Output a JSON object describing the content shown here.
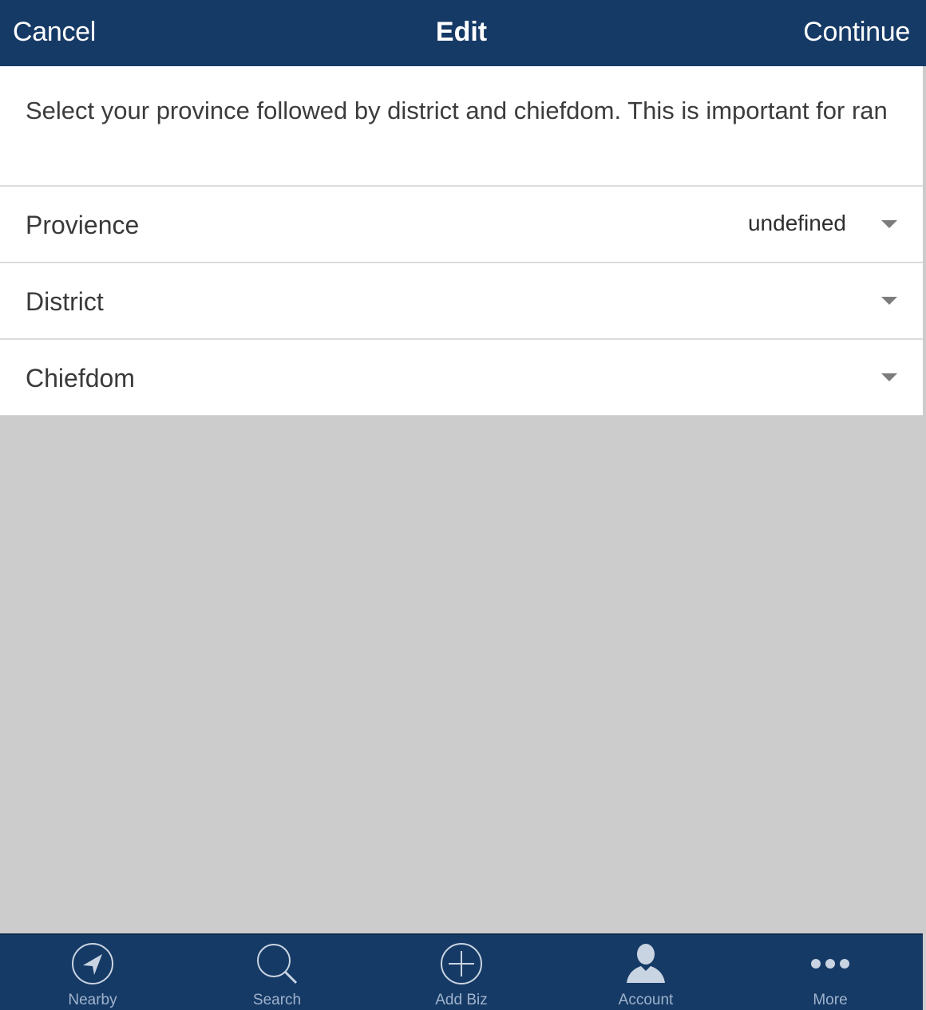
{
  "navbar": {
    "left_button": "Cancel",
    "title": "Edit",
    "right_button": "Continue"
  },
  "instruction": "Select your province followed by district and chiefdom. This is important for ran",
  "fields": [
    {
      "label": "Provience",
      "value": "undefined"
    },
    {
      "label": "District",
      "value": ""
    },
    {
      "label": "Chiefdom",
      "value": ""
    }
  ],
  "tabbar": {
    "tabs": [
      {
        "label": "Nearby",
        "icon": "location-arrow-icon"
      },
      {
        "label": "Search",
        "icon": "search-icon"
      },
      {
        "label": "Add Biz",
        "icon": "add-circle-icon"
      },
      {
        "label": "Account",
        "icon": "person-icon"
      },
      {
        "label": "More",
        "icon": "more-dots-icon"
      }
    ]
  },
  "colors": {
    "navbar_bg": "#163a66",
    "tab_label": "#9fb3cc",
    "background": "#cccccc"
  }
}
